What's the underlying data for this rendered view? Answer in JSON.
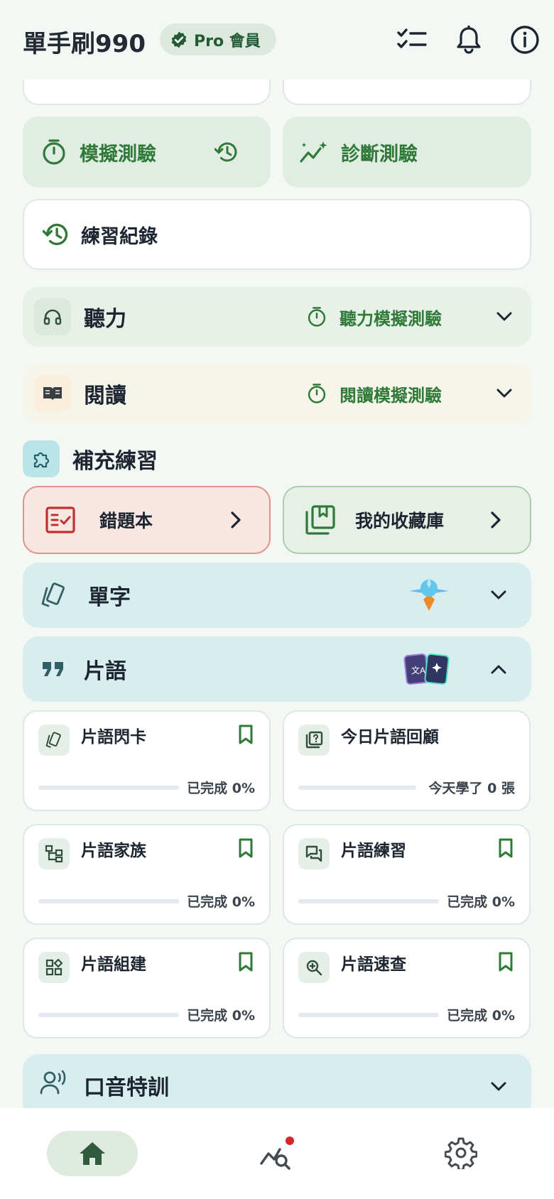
{
  "app": {
    "title": "單手刷990",
    "badge": "Pro 會員"
  },
  "topbar_icons": [
    "checklist-icon",
    "bell-icon",
    "info-icon"
  ],
  "practice": {
    "mock_test": "模擬測驗",
    "diagnostic_test": "診斷測驗",
    "history": "練習紀錄"
  },
  "sections": {
    "listening": {
      "label": "聽力",
      "action": "聽力模擬測驗"
    },
    "reading": {
      "label": "閱讀",
      "action": "閱讀模擬測驗"
    }
  },
  "supplementary": {
    "title": "補充練習",
    "wrong_book": "錯題本",
    "favorites": "我的收藏庫"
  },
  "vocab": {
    "label": "單字"
  },
  "phrases": {
    "label": "片語",
    "tiles": [
      {
        "title": "片語閃卡",
        "progress": "已完成 0%",
        "value": 0
      },
      {
        "title": "今日片語回顧",
        "progress": "今天學了 0 張",
        "value": 0
      },
      {
        "title": "片語家族",
        "progress": "已完成 0%",
        "value": 0
      },
      {
        "title": "片語練習",
        "progress": "已完成 0%",
        "value": 0
      },
      {
        "title": "片語組建",
        "progress": "已完成 0%",
        "value": 0
      },
      {
        "title": "片語速查",
        "progress": "已完成 0%",
        "value": 0
      }
    ]
  },
  "accent": {
    "label": "口音特訓"
  },
  "colors": {
    "accent_green": "#2f7a38",
    "listening_bg": "#e8f1e8",
    "reading_bg": "#f6f5ea",
    "wrong_book_bg": "#f8e6e3",
    "teal_bg": "#d8eeee",
    "notification_dot": "#d8262f"
  },
  "bottom_nav": [
    "home-icon",
    "analytics-icon",
    "settings-icon"
  ]
}
